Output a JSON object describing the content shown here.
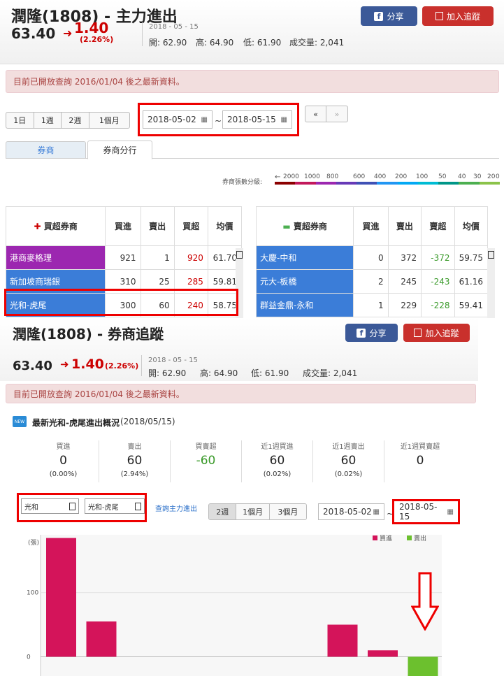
{
  "top": {
    "title": "潤隆(1808) - 主力進出",
    "price": "63.40",
    "change": "1.40",
    "change_pct": "(2.26%)",
    "date": "2018 - 05 - 15",
    "open": "開: 62.90",
    "high": "高: 64.90",
    "low": "低: 61.90",
    "volume": "成交量: 2,041",
    "share_label": "分享",
    "track_label": "加入追蹤",
    "notice": "目前已開放查詢 2016/01/04 後之最新資料。",
    "periods": [
      "1日",
      "1週",
      "2週",
      "1個月"
    ],
    "date_from": "2018-05-02",
    "tilde": "~",
    "date_to": "2018-05-15",
    "prev": "«",
    "next": "»",
    "tabs": [
      "券商",
      "券商分行"
    ],
    "legend_title": "券商張數分級:",
    "legend_arrow": "←",
    "legend_ticks": [
      "2000",
      "1000",
      "800",
      "600",
      "400",
      "200",
      "100",
      "50",
      "40",
      "30",
      "20",
      "0"
    ],
    "buy_table": {
      "headers": [
        "買超券商",
        "買進",
        "賣出",
        "買超",
        "均價"
      ],
      "rows": [
        {
          "name": "港商麥格理",
          "buy": "921",
          "sell": "1",
          "net": "920",
          "avg": "61.70",
          "color": "#9c27b0"
        },
        {
          "name": "新加坡商瑞銀",
          "buy": "310",
          "sell": "25",
          "net": "285",
          "avg": "59.81",
          "color": "#3b7dd8"
        },
        {
          "name": "光和-虎尾",
          "buy": "300",
          "sell": "60",
          "net": "240",
          "avg": "58.75",
          "color": "#3b7dd8"
        }
      ]
    },
    "sell_table": {
      "headers": [
        "賣超券商",
        "買進",
        "賣出",
        "賣超",
        "均價"
      ],
      "rows": [
        {
          "name": "大慶-中和",
          "buy": "0",
          "sell": "372",
          "net": "-372",
          "avg": "59.75",
          "color": "#3b7dd8"
        },
        {
          "name": "元大-板橋",
          "buy": "2",
          "sell": "245",
          "net": "-243",
          "avg": "61.16",
          "color": "#3b7dd8"
        },
        {
          "name": "群益金鼎-永和",
          "buy": "1",
          "sell": "229",
          "net": "-228",
          "avg": "59.41",
          "color": "#3b7dd8"
        }
      ]
    },
    "legend_colors": [
      "#8b0000",
      "#c2185b",
      "#9c27b0",
      "#673ab7",
      "#3f51b5",
      "#2196f3",
      "#03a9f4",
      "#00bcd4",
      "#009688",
      "#4caf50",
      "#8bc34a"
    ]
  },
  "bottom": {
    "title": "潤隆(1808) - 券商追蹤",
    "price": "63.40",
    "change": "1.40",
    "change_pct": "(2.26%)",
    "date": "2018 - 05 - 15",
    "open": "開: 62.90",
    "high": "高: 64.90",
    "low": "低: 61.90",
    "volume": "成交量: 2,041",
    "share_label": "分享",
    "track_label": "加入追蹤",
    "notice": "目前已開放查詢 2016/01/04 後之最新資料。",
    "new_badge": "NEW",
    "section_title": "最新光和-虎尾進出概況",
    "section_date": "(2018/05/15)",
    "stats": [
      {
        "label": "買進",
        "value": "0",
        "pct": "(0.00%)"
      },
      {
        "label": "賣出",
        "value": "60",
        "pct": "(2.94%)"
      },
      {
        "label": "買賣超",
        "value": "-60",
        "pct": ""
      },
      {
        "label": "近1週買進",
        "value": "60",
        "pct": "(0.02%)"
      },
      {
        "label": "近1週賣出",
        "value": "60",
        "pct": "(0.02%)"
      },
      {
        "label": "近1週買賣超",
        "value": "0",
        "pct": ""
      }
    ],
    "broker_select": "光和",
    "branch_select": "光和-虎尾",
    "query_link": "查詢主力進出",
    "periods": [
      "2週",
      "1個月",
      "3個月"
    ],
    "date_from": "2018-05-02",
    "tilde": "~",
    "date_to": "2018-05-15"
  },
  "chart_data": {
    "type": "bar",
    "ylabel": "(張)",
    "y_ticks": [
      "100",
      "0"
    ],
    "legend": [
      "買進",
      "賣出"
    ],
    "colors": {
      "buy": "#d4145a",
      "sell": "#6cc02e"
    },
    "ylim": [
      -30,
      190
    ],
    "bars": [
      {
        "index": 0,
        "value": 185,
        "series": "買進"
      },
      {
        "index": 1,
        "value": 55,
        "series": "買進"
      },
      {
        "index": 7,
        "value": 50,
        "series": "買進"
      },
      {
        "index": 8,
        "value": 10,
        "series": "買進"
      },
      {
        "index": 9,
        "value": -60,
        "series": "賣出"
      }
    ]
  }
}
